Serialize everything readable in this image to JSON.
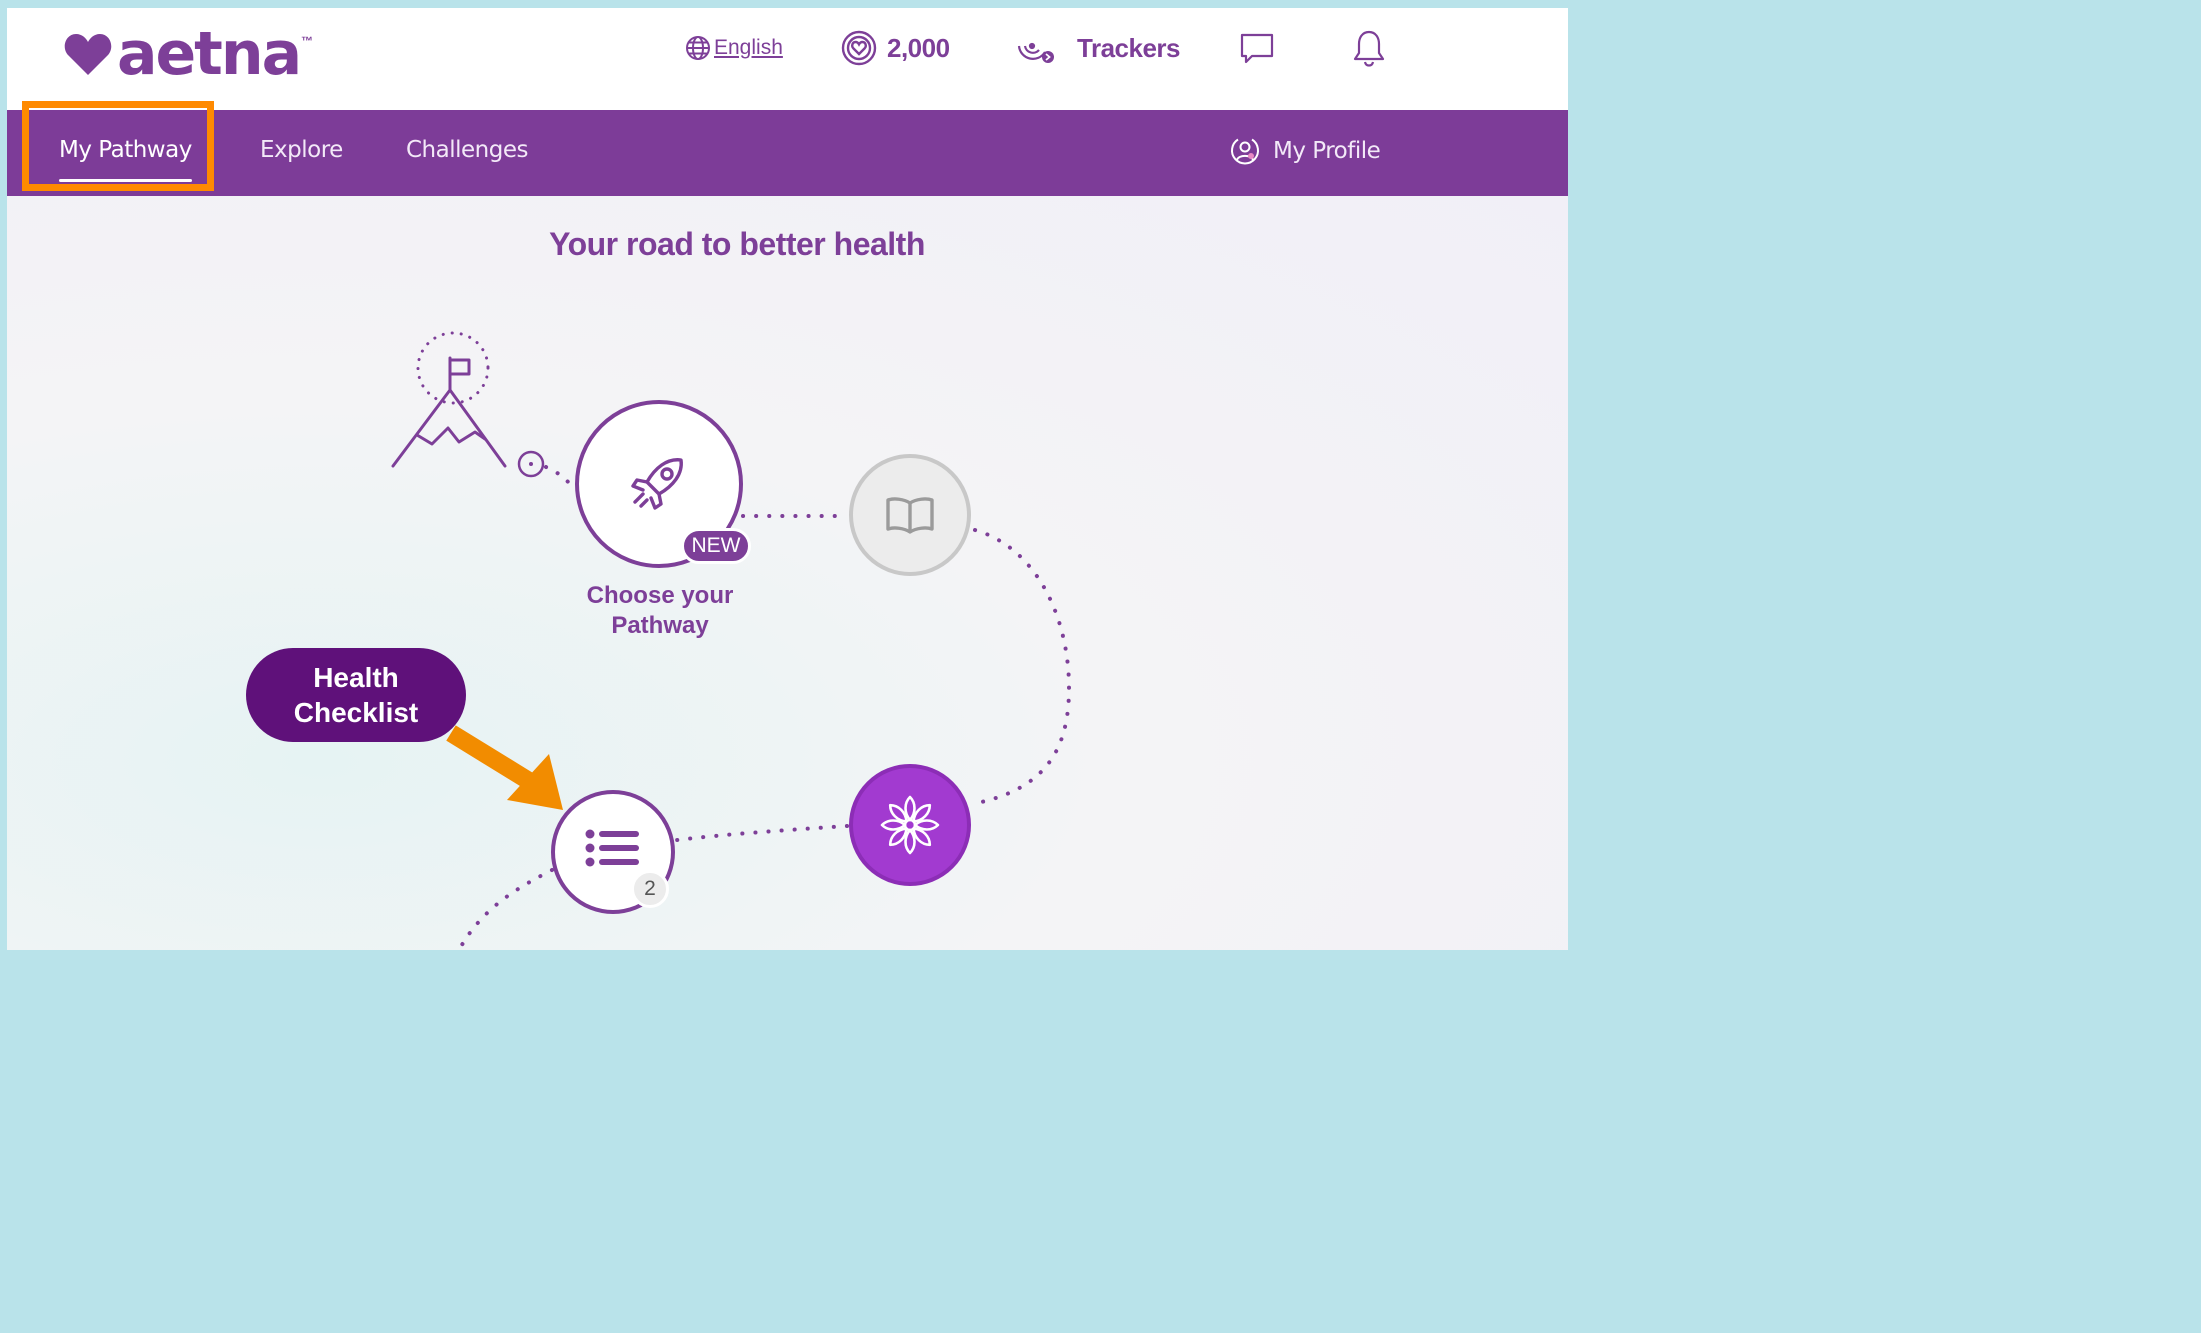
{
  "brand": {
    "logo_text": "aetna",
    "trademark": "™",
    "color": "#7d3f98"
  },
  "header": {
    "language_label": "English",
    "points_value": "2,000",
    "trackers_label": "Trackers",
    "icons": [
      "globe-icon",
      "points-coin-icon",
      "trackers-icon",
      "chat-icon",
      "bell-icon"
    ]
  },
  "nav": {
    "tabs": [
      {
        "label": "My Pathway",
        "active": true
      },
      {
        "label": "Explore"
      },
      {
        "label": "Challenges"
      }
    ],
    "profile_label": "My Profile",
    "background": "#7d3c98"
  },
  "main": {
    "title": "Your road to better health",
    "nodes": {
      "choose_pathway": {
        "badge": "NEW",
        "label": "Choose your Pathway",
        "icon": "rocket-icon"
      },
      "learn": {
        "icon": "book-icon",
        "state": "locked"
      },
      "mindfulness": {
        "icon": "flower-icon",
        "color": "#a23ad0"
      },
      "checklist": {
        "icon": "checklist-icon",
        "count": "2"
      }
    },
    "goal_icon": "mountain-flag-icon"
  },
  "annotation": {
    "callout_line1": "Health",
    "callout_line2": "Checklist",
    "highlight_color": "#ff8a00",
    "callout_color": "#5f117a"
  }
}
